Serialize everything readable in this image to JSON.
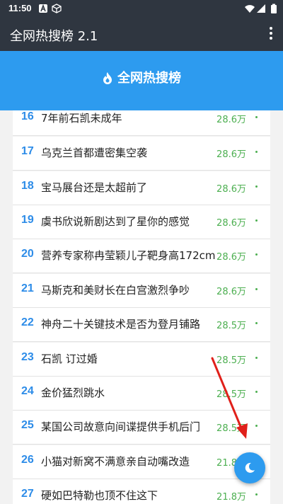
{
  "statusbar": {
    "time": "11:50"
  },
  "appbar": {
    "title": "全网热搜榜 2.1"
  },
  "banner": {
    "title": "全网热搜榜"
  },
  "items": [
    {
      "rank": "16",
      "title": "7年前石凯未成年",
      "count": "28.6万"
    },
    {
      "rank": "17",
      "title": "乌克兰首都遭密集空袭",
      "count": "28.6万"
    },
    {
      "rank": "18",
      "title": "宝马展台还是太超前了",
      "count": "28.6万"
    },
    {
      "rank": "19",
      "title": "虞书欣说新剧达到了星你的感觉",
      "count": "28.6万"
    },
    {
      "rank": "20",
      "title": "营养专家称冉莹颖儿子靶身高172cm",
      "count": "28.6万"
    },
    {
      "rank": "21",
      "title": "马斯克和美财长在白宫激烈争吵",
      "count": "28.6万"
    },
    {
      "rank": "22",
      "title": "神舟二十关键技术是否为登月铺路",
      "count": "28.5万"
    },
    {
      "rank": "23",
      "title": "石凯 订过婚",
      "count": "28.5万"
    },
    {
      "rank": "24",
      "title": "金价猛烈跳水",
      "count": "28.5万"
    },
    {
      "rank": "25",
      "title": "某国公司故意向间谍提供手机后门",
      "count": "28.5万"
    },
    {
      "rank": "26",
      "title": "小猫对新窝不满意亲自动嘴改造",
      "count": "21.8万"
    },
    {
      "rank": "27",
      "title": "硬如巴特勒也顶不住这下",
      "count": "21.8万"
    }
  ],
  "colors": {
    "appbar": "#2f3640",
    "accent": "#2d9bef",
    "count": "#4caf50",
    "rank": "#2d8ce8"
  },
  "icons": {
    "flame": "flame-icon",
    "night": "moon-icon",
    "menu": "more-vert-icon"
  }
}
